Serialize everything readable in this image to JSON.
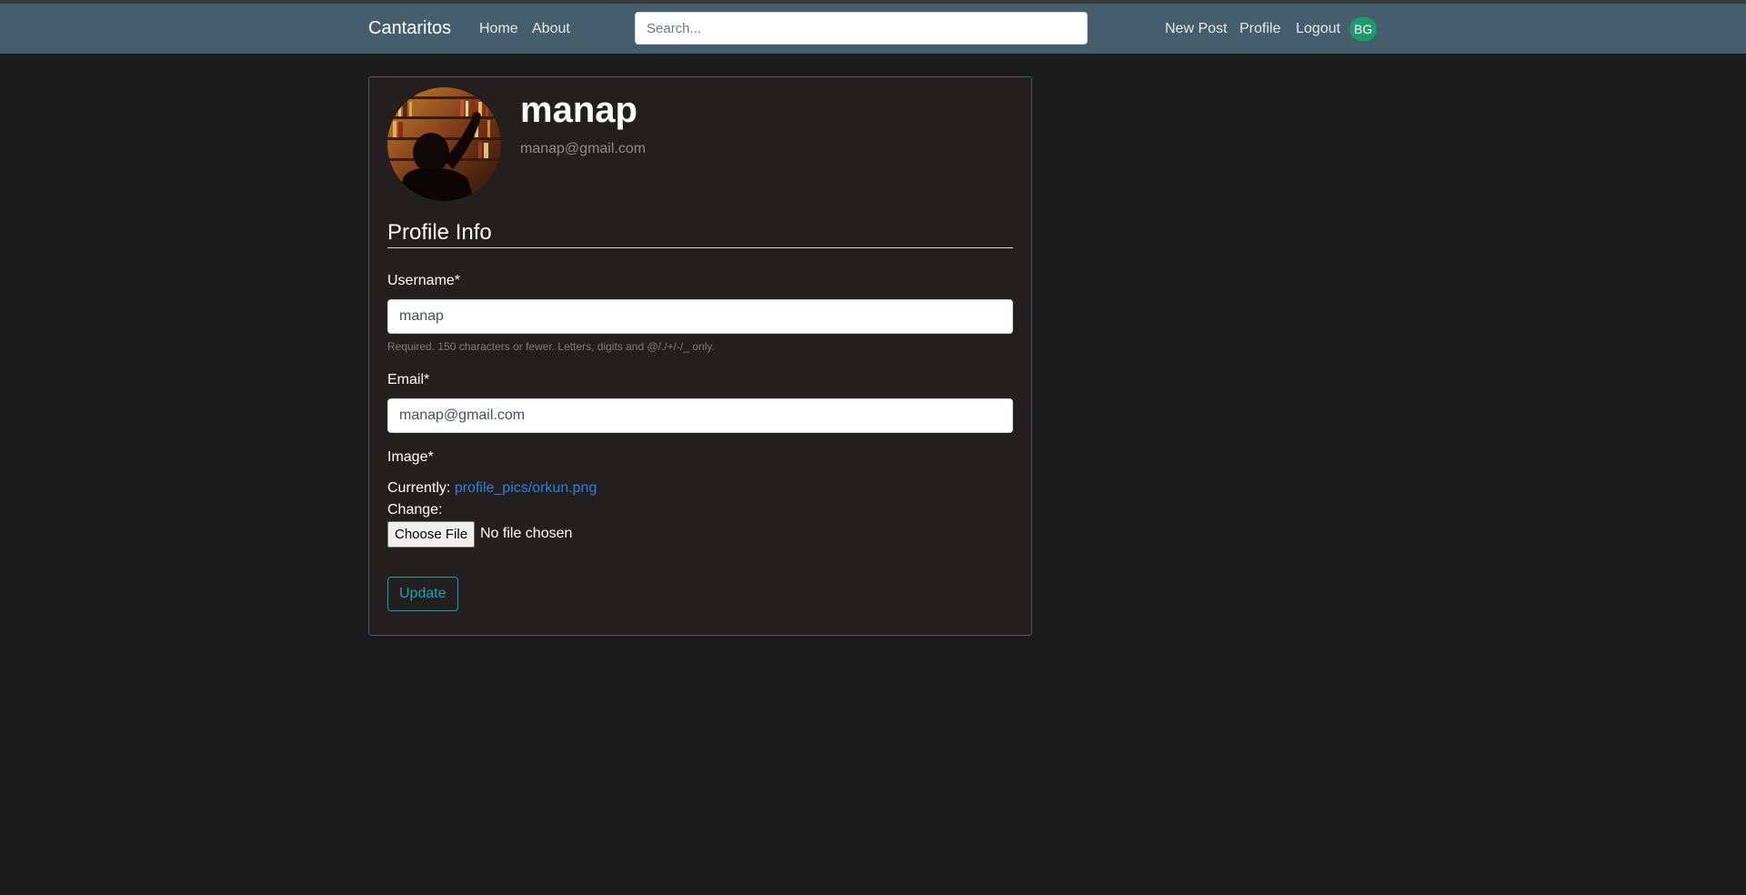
{
  "navbar": {
    "brand": "Cantaritos",
    "links": {
      "home": "Home",
      "about": "About",
      "new_post": "New Post",
      "profile": "Profile",
      "logout": "Logout"
    },
    "search_placeholder": "Search...",
    "user_initials": "BG"
  },
  "profile": {
    "username": "manap",
    "email": "manap@gmail.com"
  },
  "form": {
    "section_title": "Profile Info",
    "username_label": "Username*",
    "username_value": "manap",
    "username_help": "Required. 150 characters or fewer. Letters, digits and @/./+/-/_ only.",
    "email_label": "Email*",
    "email_value": "manap@gmail.com",
    "image_label": "Image*",
    "currently_label": "Currently:",
    "current_file": "profile_pics/orkun.png",
    "change_label": "Change:",
    "choose_file_label": "Choose File",
    "file_status": "No file chosen",
    "submit_label": "Update"
  },
  "colors": {
    "page_bg": "#1c1b1b",
    "navbar_bg": "#445e6d",
    "card_bg": "#221f1e",
    "card_border": "#4c5572",
    "link": "#2f7de1",
    "update_button": "#17a2b8",
    "avatar_badge": "#1e9b6e"
  }
}
